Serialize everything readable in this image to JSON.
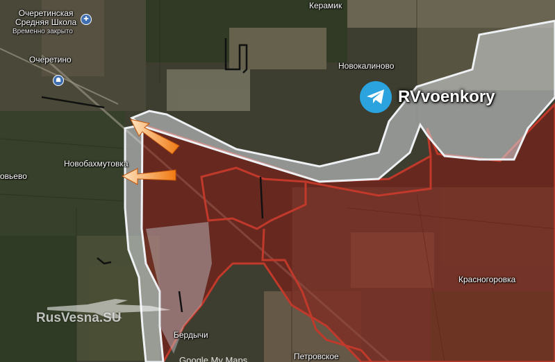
{
  "places": {
    "ocheretinskaya_school": "Очеретинская\nСредняя Школа",
    "school_status": "Временно закрыто",
    "ocheretino": "Очеретино",
    "keramik": "Керамик",
    "novokalinovo": "Новокалиново",
    "novobakhmutovka": "Новобахмутовка",
    "solovyevo_partial": "овьево",
    "krasnogorovka": "Красногоровка",
    "berdychi": "Бердычи",
    "petrovskoe": "Петровское"
  },
  "brand": {
    "name": "RVvoenkory",
    "icon": "telegram-icon"
  },
  "watermark": "RusVesna.SU",
  "attribution": "Google My Maps",
  "colors": {
    "controlled_fill": "#8b1a12",
    "controlled_border": "#c0392b",
    "contested_fill": "#d9dde2",
    "contested_border": "#eef1f4",
    "arrow": "#f07a12",
    "front_line": "#111111"
  },
  "icons": {
    "school": "school-icon",
    "police": "police-icon"
  }
}
